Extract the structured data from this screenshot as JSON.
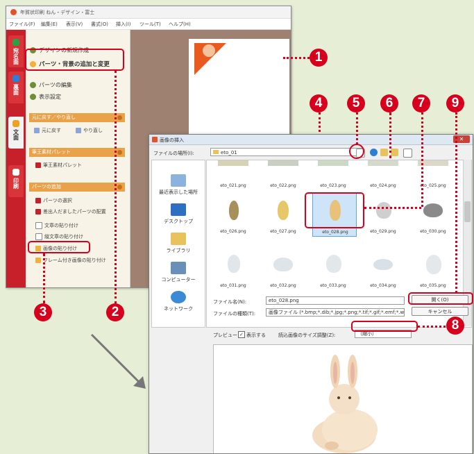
{
  "app": {
    "title": "年賀状印刷 ねん・デザイン・富士",
    "menu": [
      "ファイル(F)",
      "編集(E)",
      "表示(V)",
      "書式(O)",
      "挿入(I)",
      "ツール(T)",
      "ヘルプ(H)"
    ],
    "vtabs": [
      "宛名面",
      "裏面",
      "文面",
      "印刷"
    ],
    "nav": {
      "new_design": "デザインの新規作成",
      "add_parts": "パーツ・背景の追加と変更",
      "edit_parts": "パーツの編集",
      "display_settings": "表示設定"
    },
    "sections": {
      "undo_redo": "元に戻す／やり直し",
      "undo": "元に戻す",
      "redo": "やり直し",
      "palette": "筆王素材パレット",
      "palette_item": "筆王素材パレット",
      "parts_add": "パーツの追加",
      "parts_items": [
        "パーツの選択",
        "差出人だましたパーツの配置",
        "文章の貼り付け",
        "縦文章の貼り付け",
        "画像の貼り付け",
        "フレーム付き画像の貼り付け"
      ]
    }
  },
  "dialog": {
    "title": "画像の挿入",
    "look_in_label": "ファイルの場所(I):",
    "look_in_value": "eto_01",
    "places": [
      "最近表示した場所",
      "デスクトップ",
      "ライブラリ",
      "コンピューター",
      "ネットワーク"
    ],
    "files": [
      "eto_021.png",
      "eto_022.png",
      "eto_023.png",
      "eto_024.png",
      "eto_025.png",
      "eto_026.png",
      "eto_027.png",
      "eto_028.png",
      "eto_029.png",
      "eto_030.png",
      "eto_031.png",
      "eto_032.png",
      "eto_033.png",
      "eto_034.png",
      "eto_035.png"
    ],
    "selected_file": "eto_028.png",
    "filename_label": "ファイル名(N):",
    "filename_value": "eto_028.png",
    "filetype_label": "ファイルの種類(T):",
    "filetype_value": "画像ファイル (*.bmp;*.dib;*.jpg;*.png;*.tif;*.gif;*.emf;*.wmf)",
    "open_button": "開く(O)",
    "cancel_button": "キャンセル",
    "preview_label": "プレビュー",
    "show_label": "表示する",
    "resize_label": "読込画像のサイズ調整(Z):",
    "resize_value": "（縮小）"
  },
  "callouts": [
    "1",
    "2",
    "3",
    "4",
    "5",
    "6",
    "7",
    "8",
    "9"
  ],
  "colors": {
    "callout": "#d6001c",
    "background": "#e6efd6",
    "app_tab": "#c8202a"
  }
}
